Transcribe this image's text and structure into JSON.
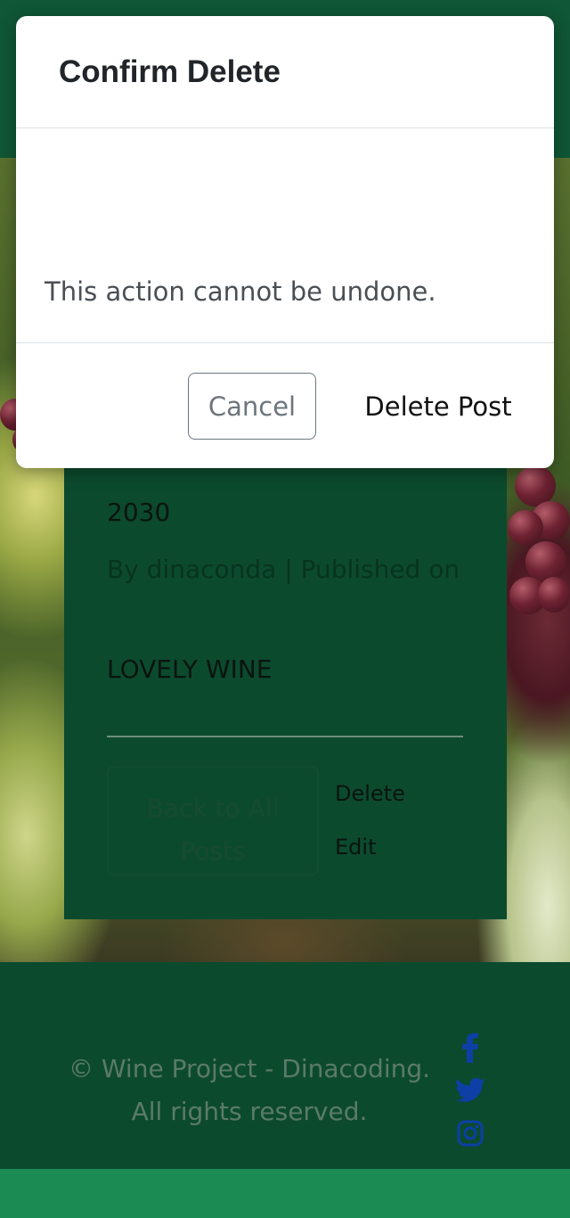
{
  "modal": {
    "title": "Confirm Delete",
    "message": "This action cannot be undone.",
    "cancel_label": "Cancel",
    "delete_label": "Delete Post"
  },
  "post": {
    "date": "2030",
    "meta": "By dinaconda | Published on",
    "body": "LOVELY WINE",
    "back_label": "Back to All Posts",
    "delete_link": "Delete",
    "edit_link": "Edit"
  },
  "footer": {
    "line1": "© Wine Project - Dinacoding.",
    "line2": "All rights reserved.",
    "social_icons": [
      "facebook-icon",
      "twitter-icon",
      "instagram-icon"
    ]
  },
  "colors": {
    "brand_green": "#0c4a2e",
    "accent_green": "#1b8a53",
    "social_blue": "#0d3fa6"
  }
}
